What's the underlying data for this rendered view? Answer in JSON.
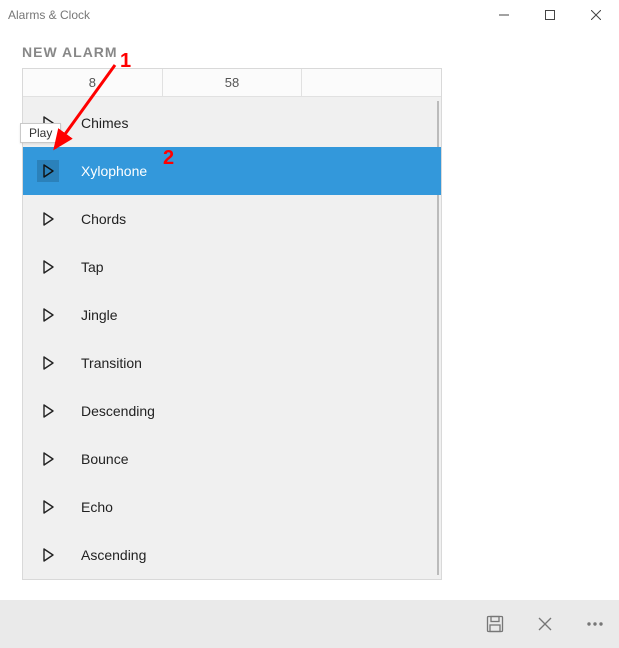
{
  "app_title": "Alarms & Clock",
  "page_title": "NEW ALARM",
  "time": {
    "hour": "8",
    "minute": "58"
  },
  "tooltip": "Play",
  "sounds": [
    {
      "label": "Chimes",
      "selected": false
    },
    {
      "label": "Xylophone",
      "selected": true
    },
    {
      "label": "Chords",
      "selected": false
    },
    {
      "label": "Tap",
      "selected": false
    },
    {
      "label": "Jingle",
      "selected": false
    },
    {
      "label": "Transition",
      "selected": false
    },
    {
      "label": "Descending",
      "selected": false
    },
    {
      "label": "Bounce",
      "selected": false
    },
    {
      "label": "Echo",
      "selected": false
    },
    {
      "label": "Ascending",
      "selected": false
    }
  ],
  "annotations": {
    "num1": "1",
    "num2": "2"
  },
  "colors": {
    "accent": "#3398db",
    "annotation": "#ff0000"
  }
}
